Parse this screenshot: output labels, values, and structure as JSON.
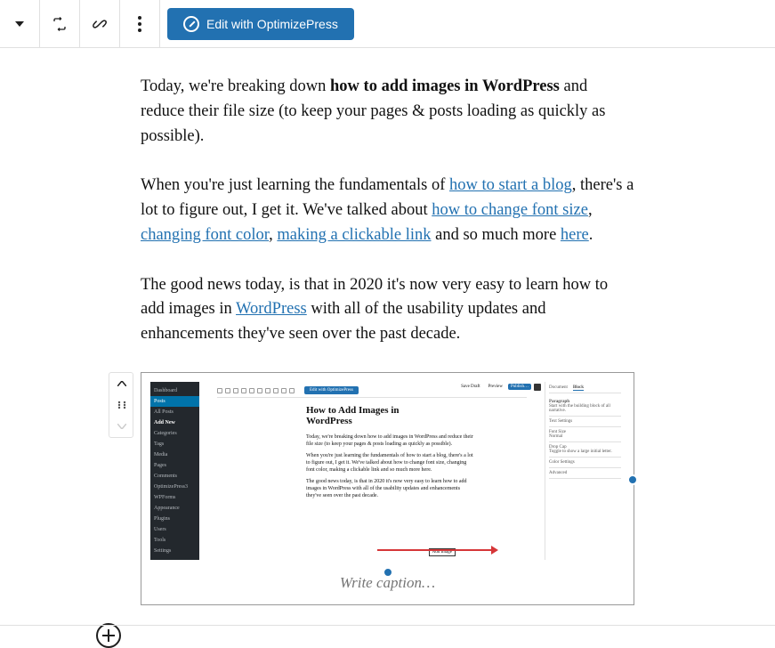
{
  "toolbar": {
    "optimize_label": "Edit with OptimizePress"
  },
  "content": {
    "p1_prefix": "Today, we're breaking down ",
    "p1_bold": "how to add images in WordPress",
    "p1_suffix": " and reduce their file size (to keep your pages & posts loading as quickly as possible).",
    "p2_a": "When you're just learning the fundamentals of ",
    "p2_link1": "how to start a blog",
    "p2_b": ", there's a lot to figure out, I get it. We've talked about ",
    "p2_link2": "how to change font size",
    "p2_c": ", ",
    "p2_link3": "changing font color",
    "p2_d": ", ",
    "p2_link4": "making a clickable link",
    "p2_e": " and so much more ",
    "p2_link5": "here",
    "p2_f": ".",
    "p3_a": "The good news today, is that in 2020 it's now very easy to learn how to add images in ",
    "p3_link1": "WordPress",
    "p3_b": " with all of the usability updates and enhancements they've seen over the past decade."
  },
  "caption_placeholder": "Write caption…",
  "inner": {
    "sidebar": [
      "Dashboard",
      "Posts",
      "All Posts",
      "Add New",
      "Categories",
      "Tags",
      "Media",
      "Pages",
      "Comments",
      "OptimizePress3",
      "WPForms",
      "Appearance",
      "Plugins",
      "Users",
      "Tools",
      "Settings"
    ],
    "title": "How to Add Images in WordPress",
    "p1": "Today, we're breaking down how to add images in WordPress and reduce their file size (to keep your pages & posts loading as quickly as possible).",
    "p2": "When you're just learning the fundamentals of how to start a blog, there's a lot to figure out, I get it. We've talked about how to change font size, changing font color, making a clickable link and so much more here.",
    "p3": "The good news today, is that in 2020 it's now very easy to learn how to add images in WordPress with all of the usability updates and enhancements they've seen over the past decade.",
    "right_tabs": [
      "Document",
      "Block"
    ],
    "right_block": "Paragraph",
    "right_desc": "Start with the building block of all narrative.",
    "right_sections": [
      "Text Settings",
      "Font Size",
      "Normal",
      "Drop Cap",
      "Toggle to show a large initial letter.",
      "Color Settings",
      "Advanced"
    ],
    "save": [
      "Save Draft",
      "Preview",
      "Publish…"
    ],
    "add_image": "Add Image"
  }
}
